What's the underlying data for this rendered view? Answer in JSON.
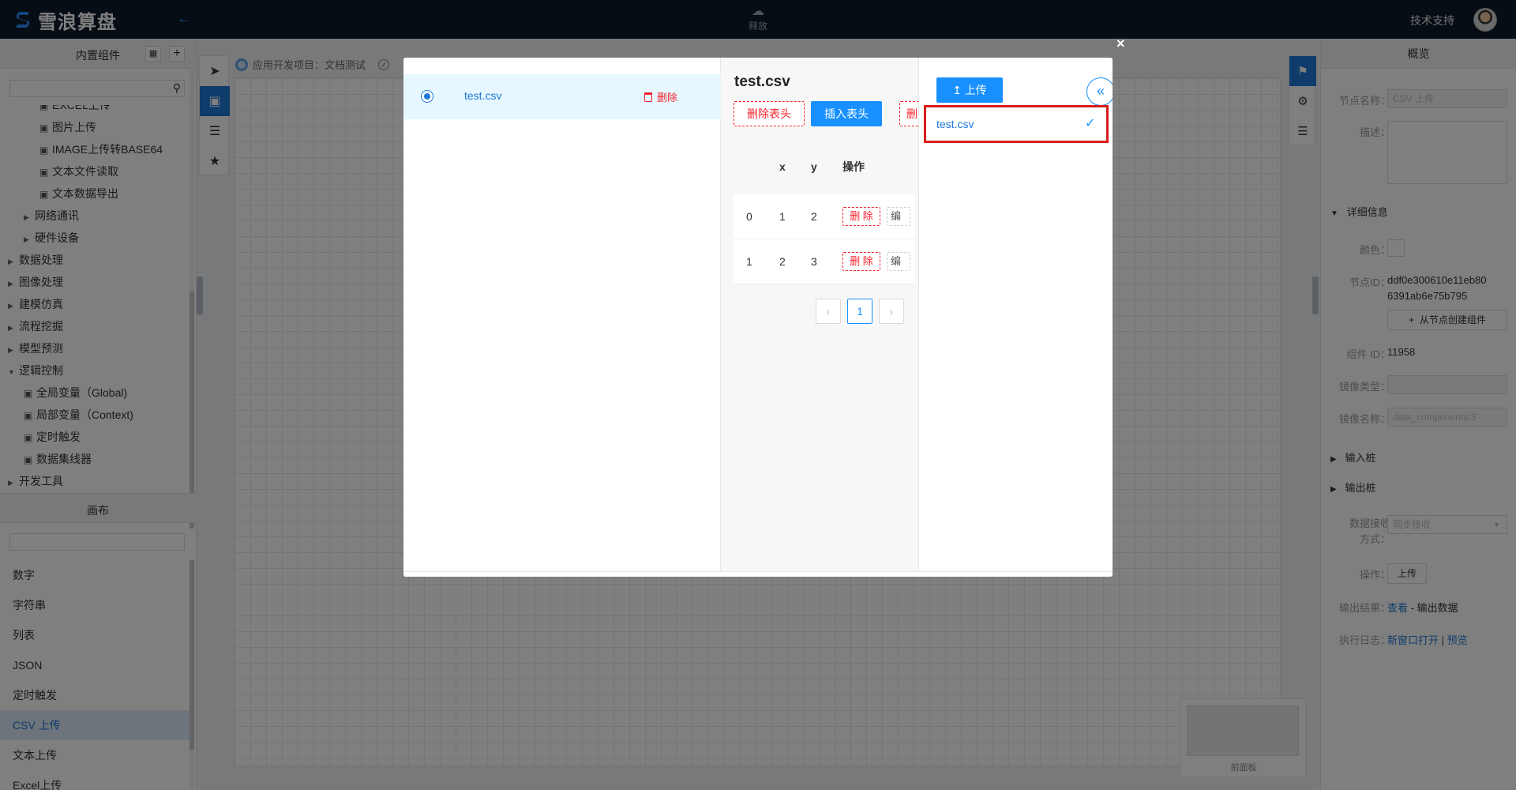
{
  "app": {
    "logo_text": "雪浪算盘",
    "release_label": "释放",
    "support_label": "技术支持"
  },
  "left_panel": {
    "title": "内置组件",
    "tree": [
      {
        "label": "EXCEL上传",
        "level": 2,
        "kind": "leaf"
      },
      {
        "label": "图片上传",
        "level": 2,
        "kind": "leaf"
      },
      {
        "label": "IMAGE上传转BASE64",
        "level": 2,
        "kind": "leaf"
      },
      {
        "label": "文本文件读取",
        "level": 2,
        "kind": "leaf"
      },
      {
        "label": "文本数据导出",
        "level": 2,
        "kind": "leaf"
      },
      {
        "label": "网络通讯",
        "level": 1,
        "kind": "group"
      },
      {
        "label": "硬件设备",
        "level": 1,
        "kind": "group"
      },
      {
        "label": "数据处理",
        "level": 0,
        "kind": "group"
      },
      {
        "label": "图像处理",
        "level": 0,
        "kind": "group"
      },
      {
        "label": "建模仿真",
        "level": 0,
        "kind": "group"
      },
      {
        "label": "流程挖掘",
        "level": 0,
        "kind": "group"
      },
      {
        "label": "模型预测",
        "level": 0,
        "kind": "group"
      },
      {
        "label": "逻辑控制",
        "level": 0,
        "kind": "open"
      },
      {
        "label": "全局变量（Global)",
        "level": 1,
        "kind": "leaf"
      },
      {
        "label": "局部变量（Context)",
        "level": 1,
        "kind": "leaf"
      },
      {
        "label": "定时触发",
        "level": 1,
        "kind": "leaf"
      },
      {
        "label": "数据集线器",
        "level": 1,
        "kind": "leaf"
      },
      {
        "label": "开发工具",
        "level": 0,
        "kind": "group"
      }
    ],
    "canvas_title": "画布",
    "canvas_items": [
      {
        "label": "数字",
        "active": false
      },
      {
        "label": "字符串",
        "active": false
      },
      {
        "label": "列表",
        "active": false
      },
      {
        "label": "JSON",
        "active": false
      },
      {
        "label": "定时触发",
        "active": false
      },
      {
        "label": "CSV 上传",
        "active": true
      },
      {
        "label": "文本上传",
        "active": false
      },
      {
        "label": "Excel上传",
        "active": false
      }
    ]
  },
  "breadcrumb": {
    "text": "应用开发项目：文档测试"
  },
  "minimap": {
    "label": "前面板"
  },
  "right_panel": {
    "title": "概览",
    "node_name_label": "节点名称：",
    "node_name_value": "CSV 上传",
    "desc_label": "描述：",
    "detail_section": "详细信息",
    "color_label": "颜色：",
    "node_id_label": "节点ID：",
    "node_id_line1": "ddf0e300610e11eb80",
    "node_id_line2": "6391ab6e75b795",
    "create_from_node_btn": "从节点创建组件",
    "component_id_label": "组件 ID：",
    "component_id_value": "11958",
    "image_type_label": "镜像类型：",
    "image_name_label": "镜像名称：",
    "image_name_value": "data_components:3",
    "input_section": "输入桩",
    "output_section": "输出桩",
    "receive_label_1": "数据接收",
    "receive_label_2": "方式：",
    "receive_value": "同步接收",
    "operation_label": "操作：",
    "operation_btn": "上传",
    "output_result_label": "输出结果：",
    "output_view_link": "查看",
    "output_separator": " - ",
    "output_data_text": "输出数据",
    "log_label": "执行日志：",
    "log_open_link": "新窗口打开",
    "log_separator": " | ",
    "log_preview_link": "预览"
  },
  "modal": {
    "close_symbol": "×",
    "files": [
      {
        "name": "test.csv",
        "delete_label": "删除",
        "selected": true
      }
    ],
    "preview": {
      "title": "test.csv",
      "delete_header_btn": "删除表头",
      "insert_header_btn": "插入表头",
      "third_btn_partial": "删",
      "columns": [
        "",
        "x",
        "y",
        "操作"
      ],
      "rows": [
        {
          "index": "0",
          "x": "1",
          "y": "2"
        },
        {
          "index": "1",
          "x": "2",
          "y": "3"
        }
      ],
      "row_delete_label": "删 除",
      "row_edit_label": "编",
      "current_page": "1"
    },
    "upload": {
      "upload_btn": "上传",
      "items": [
        {
          "name": "test.csv",
          "checked": true
        }
      ]
    }
  },
  "colors": {
    "topbar": "#0f1a2b",
    "accent": "#1890ff",
    "danger": "#f5222d",
    "highlight": "#d81e1e"
  }
}
